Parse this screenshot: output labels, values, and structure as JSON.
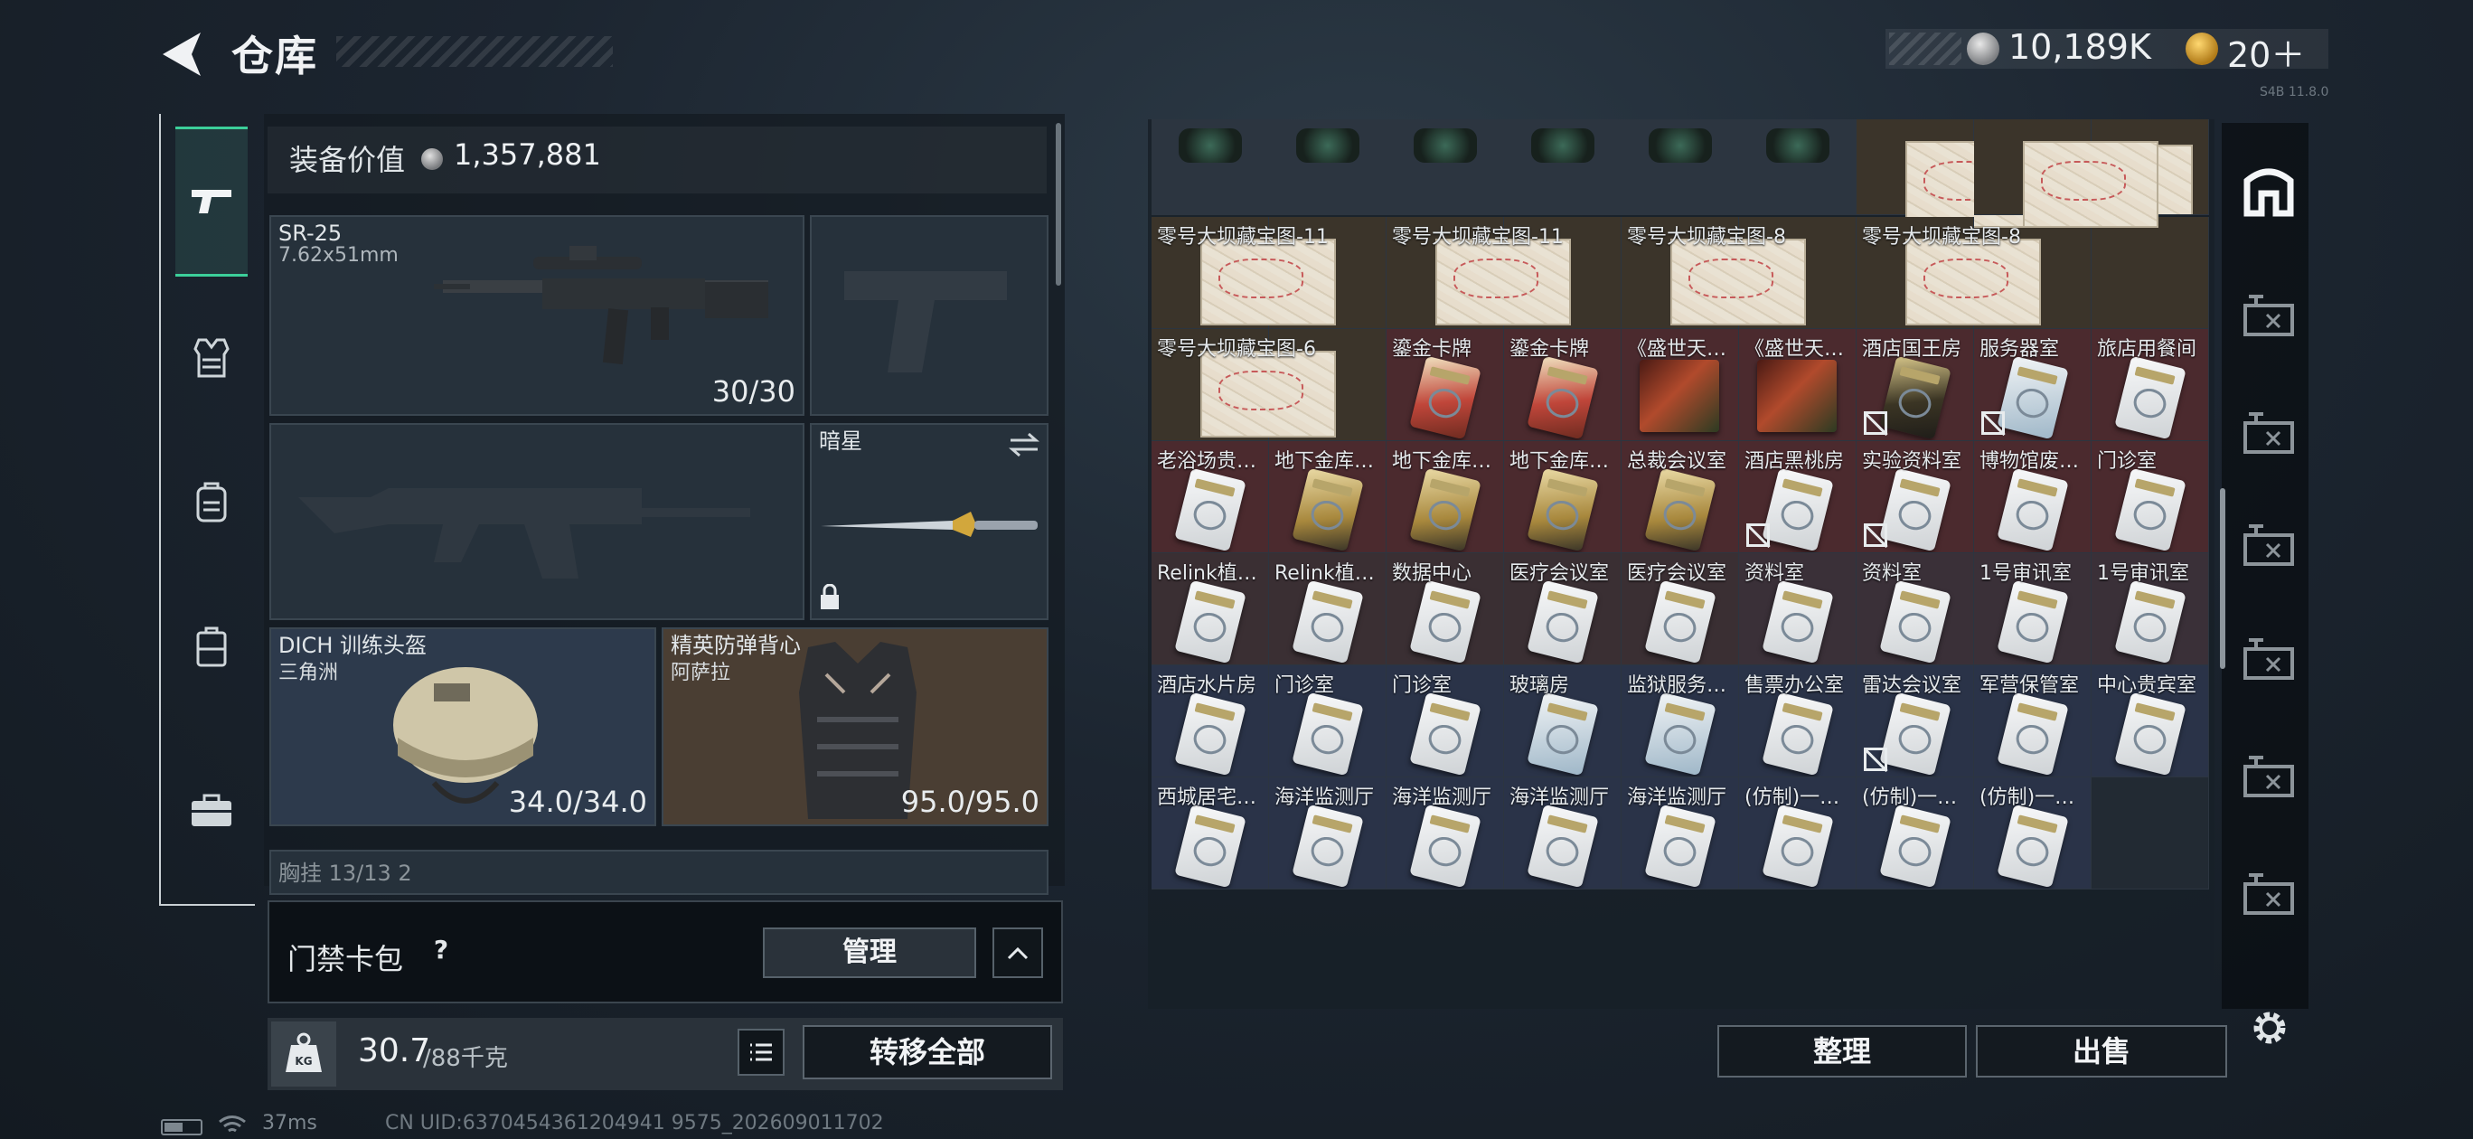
{
  "header": {
    "title": "仓库",
    "currency_balance": "10,189K",
    "ticket_count": "20＋",
    "version_text": "S4B 11.8.0"
  },
  "equipment": {
    "value_label": "装备价值",
    "value": "1,357,881",
    "primary": {
      "name": "SR-25",
      "caliber": "7.62x51mm",
      "ammo": "30/30"
    },
    "melee": {
      "name": "暗星"
    },
    "helmet": {
      "name": "DICH 训练头盔",
      "sub": "三角洲",
      "durability": "34.0/34.0"
    },
    "armor": {
      "name": "精英防弹背心",
      "sub": "阿萨拉",
      "durability": "95.0/95.0"
    },
    "rig_partial": "胸挂  13/13  2"
  },
  "cardpack": {
    "label": "门禁卡包",
    "help": "?",
    "manage_label": "管理"
  },
  "weight": {
    "current": "30.7",
    "max": "/88千克",
    "icon_text": "KG",
    "transfer_all_label": "转移全部"
  },
  "status": {
    "ping": "37ms",
    "uid": "CN UID:6370454361204941 9575_202609011702"
  },
  "storage": {
    "sort_label": "整理",
    "sell_label": "出售",
    "rows": [
      {
        "cells": [
          {
            "label": "",
            "icon": "scope"
          },
          {
            "label": "",
            "icon": "scope"
          },
          {
            "label": "",
            "icon": "scope"
          },
          {
            "label": "",
            "icon": "scope"
          },
          {
            "label": "",
            "icon": "scope"
          },
          {
            "label": "",
            "icon": "scope"
          },
          {
            "label": "",
            "icon": "map"
          },
          {
            "label": "",
            "icon": "map"
          },
          {
            "label": "",
            "icon": "map-v"
          }
        ]
      },
      {
        "cells": [
          {
            "label": "零号大坝藏宝图-11",
            "icon": "map"
          },
          {
            "label": "",
            "icon": ""
          },
          {
            "label": "零号大坝藏宝图-11",
            "icon": "map"
          },
          {
            "label": "",
            "icon": ""
          },
          {
            "label": "零号大坝藏宝图-8",
            "icon": "map"
          },
          {
            "label": "",
            "icon": ""
          },
          {
            "label": "零号大坝藏宝图-8",
            "icon": "map"
          },
          {
            "label": "",
            "icon": ""
          },
          {
            "label": "",
            "icon": ""
          }
        ]
      },
      {
        "cells": [
          {
            "label": "零号大坝藏宝图-6",
            "icon": "map"
          },
          {
            "label": "",
            "icon": ""
          },
          {
            "label": "鎏金卡牌",
            "icon": "tarot"
          },
          {
            "label": "鎏金卡牌",
            "icon": "tarot"
          },
          {
            "label": "《盛世天…",
            "icon": "book"
          },
          {
            "label": "《盛世天…",
            "icon": "book"
          },
          {
            "label": "酒店国王房",
            "icon": "dark",
            "nolock": true
          },
          {
            "label": "服务器室",
            "icon": "blue",
            "nolock": true
          },
          {
            "label": "旅店用餐间",
            "icon": "white"
          }
        ]
      },
      {
        "cells": [
          {
            "label": "老浴场贵…",
            "icon": "white"
          },
          {
            "label": "地下金库…",
            "icon": "gold"
          },
          {
            "label": "地下金库…",
            "icon": "gold"
          },
          {
            "label": "地下金库…",
            "icon": "gold"
          },
          {
            "label": "总裁会议室",
            "icon": "gold"
          },
          {
            "label": "酒店黑桃房",
            "icon": "white",
            "nolock": true
          },
          {
            "label": "实验资料室",
            "icon": "white",
            "nolock": true
          },
          {
            "label": "博物馆废…",
            "icon": "white"
          },
          {
            "label": "门诊室",
            "icon": "white"
          }
        ]
      },
      {
        "cells": [
          {
            "label": "Relink植…",
            "icon": "white"
          },
          {
            "label": "Relink植…",
            "icon": "white"
          },
          {
            "label": "数据中心",
            "icon": "white"
          },
          {
            "label": "医疗会议室",
            "icon": "white"
          },
          {
            "label": "医疗会议室",
            "icon": "white"
          },
          {
            "label": "资料室",
            "icon": "white"
          },
          {
            "label": "资料室",
            "icon": "white"
          },
          {
            "label": "1号审讯室",
            "icon": "white"
          },
          {
            "label": "1号审讯室",
            "icon": "white"
          }
        ]
      },
      {
        "cells": [
          {
            "label": "酒店水片房",
            "icon": "white"
          },
          {
            "label": "门诊室",
            "icon": "white"
          },
          {
            "label": "门诊室",
            "icon": "white"
          },
          {
            "label": "玻璃房",
            "icon": "blue"
          },
          {
            "label": "监狱服务…",
            "icon": "blue"
          },
          {
            "label": "售票办公室",
            "icon": "white"
          },
          {
            "label": "雷达会议室",
            "icon": "white",
            "nolock": true
          },
          {
            "label": "军营保管室",
            "icon": "white"
          },
          {
            "label": "中心贵宾室",
            "icon": "white"
          }
        ]
      },
      {
        "cells": [
          {
            "label": "西城居宅…",
            "icon": "white"
          },
          {
            "label": "海洋监测厅",
            "icon": "white"
          },
          {
            "label": "海洋监测厅",
            "icon": "white"
          },
          {
            "label": "海洋监测厅",
            "icon": "white"
          },
          {
            "label": "海洋监测厅",
            "icon": "white"
          },
          {
            "label": "(仿制)一…",
            "icon": "white"
          },
          {
            "label": "(仿制)一…",
            "icon": "white"
          },
          {
            "label": "(仿制)一…",
            "icon": "white"
          },
          {
            "label": "",
            "icon": ""
          }
        ]
      }
    ]
  },
  "right_tabs": [
    "building-icon",
    "gt1-icon",
    "iv-icon",
    "iv-folder-icon",
    "iv-plus-icon",
    "gt1-hand-icon",
    "v-icon"
  ],
  "colors": {
    "accent_green": "#3ccf9a",
    "row_red": "#5a2a2e",
    "row_blue": "#2a3348",
    "row_dark": "#2f3a44",
    "row_olive": "#3b342a"
  }
}
